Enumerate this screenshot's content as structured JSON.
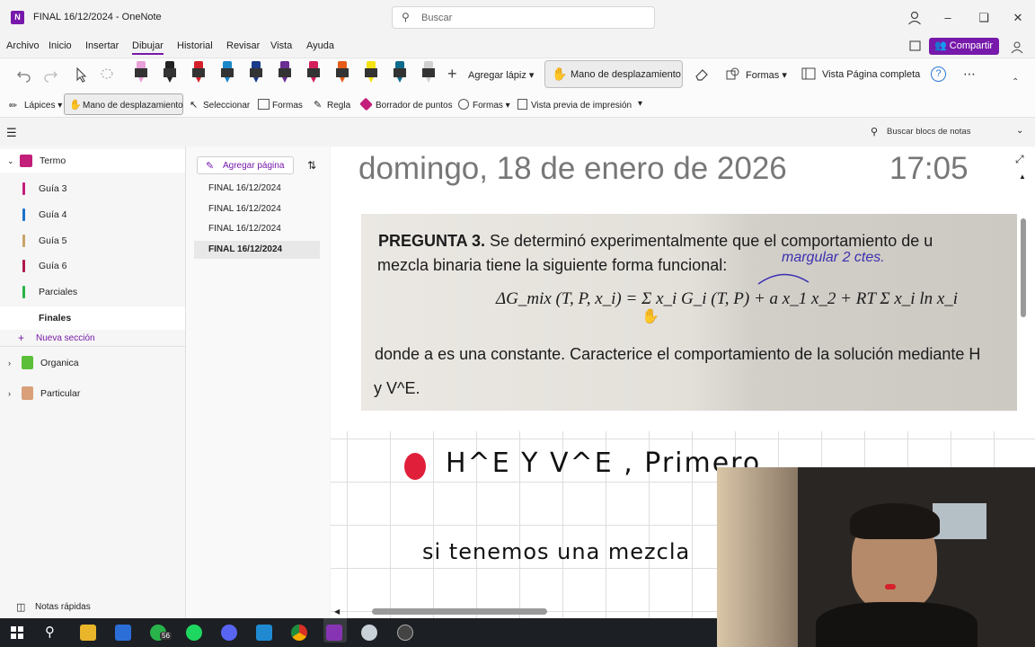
{
  "window": {
    "title": "FINAL 16/12/2024 - OneNote",
    "app_icon": "N",
    "search_placeholder": "Buscar"
  },
  "menu": [
    "Archivo",
    "Inicio",
    "Insertar",
    "Dibujar",
    "Historial",
    "Revisar",
    "Vista",
    "Ayuda"
  ],
  "share_label": "Compartir",
  "ribbon": {
    "add_pen": "Agregar lápiz",
    "hand_tool": "Mano de desplazamiento",
    "shapes": "Formas",
    "full_page": "Vista Página completa",
    "pens": [
      "#e8a0d8",
      "#222222",
      "#d4202a",
      "#1a88c9",
      "#1b3a8a",
      "#6a2d91",
      "#d41f5e",
      "#e65c1a",
      "#f5e212",
      "#0f6b8c",
      "#d0d0d0"
    ]
  },
  "toolbar2": {
    "pencils": "Lápices",
    "hand": "Mano de desplazamiento",
    "select": "Seleccionar",
    "shapes": "Formas",
    "ruler": "Regla",
    "eraser": "Borrador de puntos",
    "shapes2": "Formas",
    "print_preview": "Vista previa de impresión"
  },
  "nav": {
    "search_notebooks": "Buscar blocs de notas"
  },
  "sidebar": {
    "notebook": "Termo",
    "sections": [
      {
        "label": "Guía 3",
        "color": "#c21e7a"
      },
      {
        "label": "Guía 4",
        "color": "#1a73c9"
      },
      {
        "label": "Guía 5",
        "color": "#c9a46a"
      },
      {
        "label": "Guía 6",
        "color": "#b0194f"
      },
      {
        "label": "Parciales",
        "color": "#29b34a"
      },
      {
        "label": "Finales",
        "color": ""
      }
    ],
    "new_section": "Nueva sección",
    "other_notebooks": [
      {
        "label": "Organica",
        "color": "#5bbf3a"
      },
      {
        "label": "Particular",
        "color": "#d9a07a"
      }
    ],
    "quick_notes": "Notas rápidas"
  },
  "pages": {
    "add_page": "Agregar página",
    "items": [
      "FINAL 16/12/2024",
      "FINAL 16/12/2024",
      "FINAL 16/12/2024",
      "FINAL 16/12/2024"
    ]
  },
  "note": {
    "date": "domingo, 18 de enero de 2026",
    "time": "17:05",
    "question_bold": "PREGUNTA 3.",
    "question_line1": "Se determinó experimentalmente que el comportamiento de u",
    "question_line2": "mezcla binaria tiene la siguiente forma funcional:",
    "annotation": "margular 2 ctes.",
    "formula": "ΔG_mix (T, P, x_i) = Σ x_i G_i (T, P) + a x_1 x_2 + RT Σ x_i ln x_i",
    "question_line3": "donde a es una constante. Caracterice el comportamiento de la solución mediante H",
    "question_line4": "y V^E.",
    "hand_line1": "H^E Y V^E , Primero",
    "hand_line2": "si tenemos una mezcla"
  },
  "taskbar": {
    "badge": "56"
  }
}
